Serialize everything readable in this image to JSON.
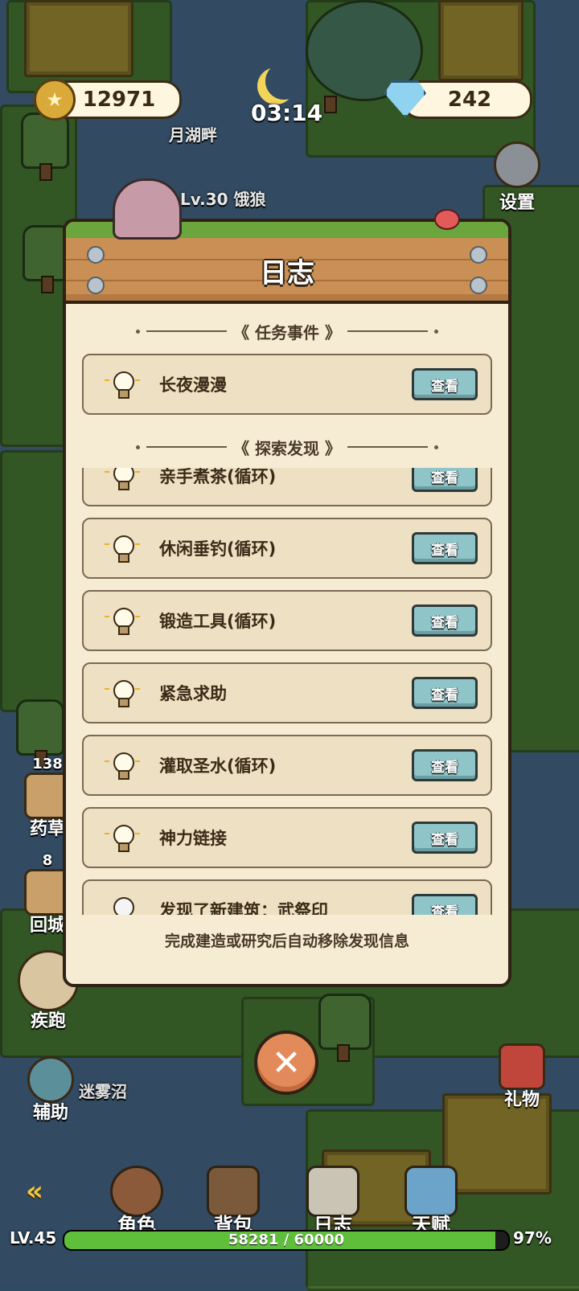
{
  "hud": {
    "coins": "12971",
    "gems": "242",
    "time": "03:14",
    "location": "月湖畔",
    "enemy_label": "Lv.30 饿狼",
    "settings_label": "设置"
  },
  "side": {
    "herb_count": "138",
    "herb_label": "药草",
    "return_count": "8",
    "return_label": "回城",
    "sprint_label": "疾跑",
    "assist_label": "辅助",
    "zone_label": "迷雾沼",
    "gift_label": "礼物"
  },
  "journal": {
    "title": "日志",
    "section_tasks": "任务事件",
    "section_explore": "探索发现",
    "view_label": "查看",
    "tasks": [
      {
        "label": "长夜漫漫",
        "lit": true
      }
    ],
    "discoveries": [
      {
        "label": "亲手煮茶(循环)",
        "lit": true
      },
      {
        "label": "休闲垂钓(循环)",
        "lit": true
      },
      {
        "label": "锻造工具(循环)",
        "lit": true
      },
      {
        "label": "紧急求助",
        "lit": true
      },
      {
        "label": "灌取圣水(循环)",
        "lit": true
      },
      {
        "label": "神力链接",
        "lit": true
      },
      {
        "label": "发现了新建筑：武祭印",
        "lit": false
      }
    ],
    "footer_note": "完成建造或研究后自动移除发现信息",
    "close_icon": "close-icon"
  },
  "nav": {
    "back_icon": "double-chevron-left-icon",
    "items": [
      {
        "label": "角色",
        "icon": "character-icon"
      },
      {
        "label": "背包",
        "icon": "backpack-icon"
      },
      {
        "label": "日志",
        "icon": "book-icon"
      },
      {
        "label": "天赋",
        "icon": "talent-icon"
      }
    ]
  },
  "player": {
    "level": "LV.45",
    "xp_text": "58281 / 60000",
    "xp_fraction": 0.971,
    "xp_percent": "97%"
  },
  "colors": {
    "accent": "#5fbf3a",
    "button": "#8fc4c8",
    "panel": "#f6ecd4"
  }
}
